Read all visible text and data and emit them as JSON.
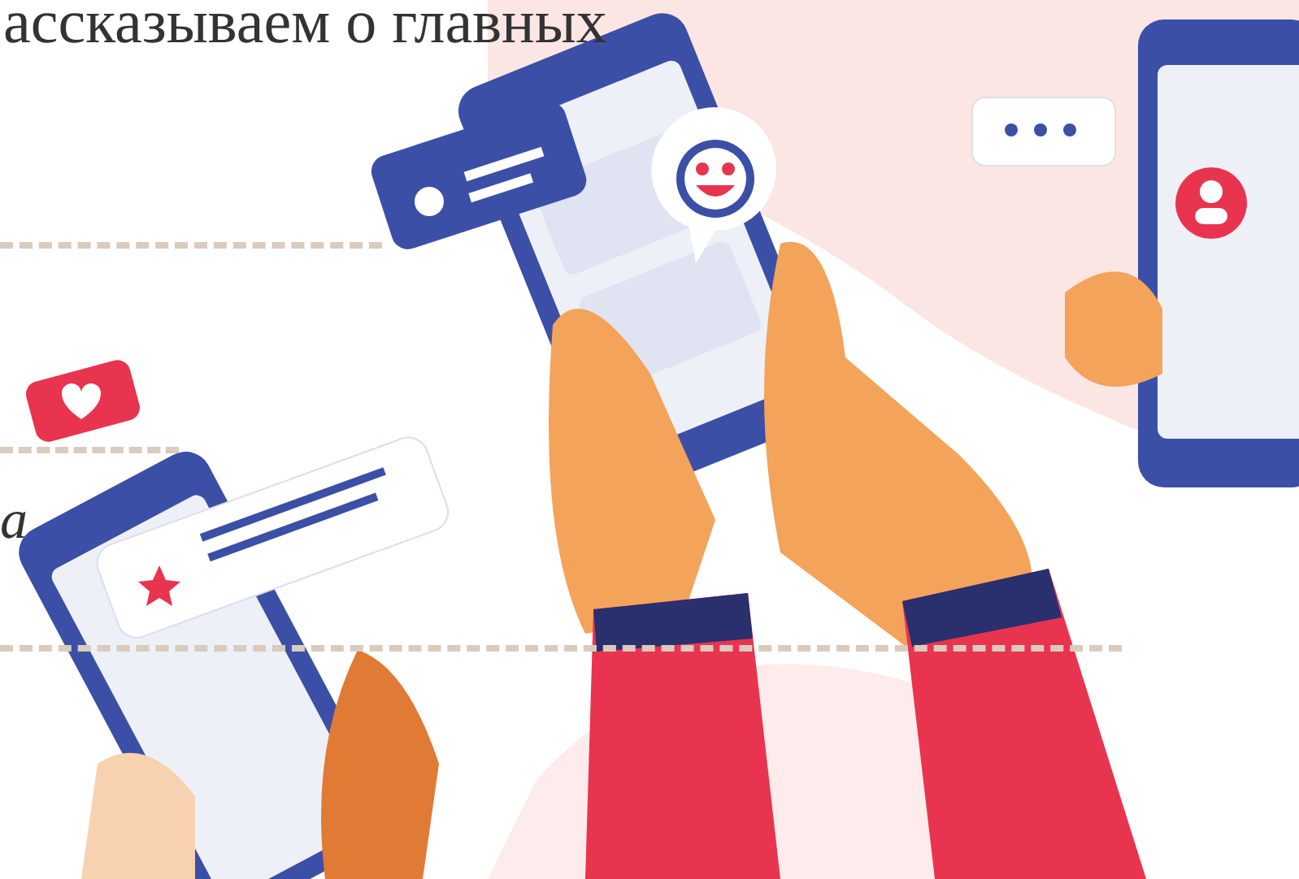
{
  "headline": "ассказываем о главных",
  "side_text": "а"
}
